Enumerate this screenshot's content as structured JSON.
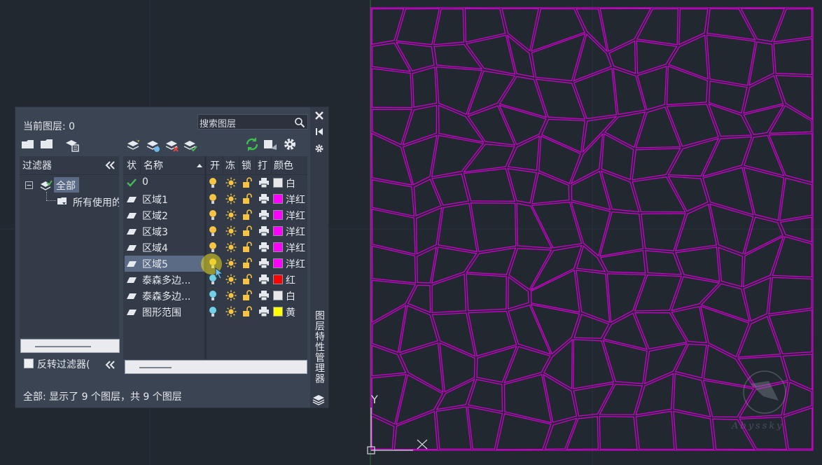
{
  "palette": {
    "current_layer": "当前图层: 0",
    "search_placeholder": "搜索图层",
    "filter_title": "过滤器",
    "filter_tree": {
      "root": "全部",
      "child": "所有使用的"
    },
    "invert_filter_label": "反转过滤器(",
    "columns": {
      "status": "状",
      "name": "名称",
      "on": "开",
      "freeze": "冻",
      "lock": "锁",
      "plot": "打",
      "color": "颜色"
    },
    "layers": [
      {
        "status": "current",
        "name": "0",
        "on": true,
        "color_name": "白",
        "color": "#e8e8e8"
      },
      {
        "status": "normal",
        "name": "区域1",
        "on": true,
        "color_name": "洋红",
        "color": "#ff00ff"
      },
      {
        "status": "normal",
        "name": "区域2",
        "on": true,
        "color_name": "洋红",
        "color": "#ff00ff"
      },
      {
        "status": "normal",
        "name": "区域3",
        "on": true,
        "color_name": "洋红",
        "color": "#ff00ff"
      },
      {
        "status": "normal",
        "name": "区域4",
        "on": true,
        "color_name": "洋红",
        "color": "#ff00ff"
      },
      {
        "status": "normal",
        "name": "区域5",
        "on": true,
        "color_name": "洋红",
        "color": "#ff00ff",
        "selected": true
      },
      {
        "status": "normal",
        "name": "泰森多边...",
        "on": false,
        "color_name": "红",
        "color": "#ff0000"
      },
      {
        "status": "normal",
        "name": "泰森多边...",
        "on": false,
        "color_name": "白",
        "color": "#e8e8e8"
      },
      {
        "status": "normal",
        "name": "图形范围",
        "on": false,
        "color_name": "黄",
        "color": "#ffff00"
      }
    ],
    "status_text": "全部: 显示了 9 个图层，共 9 个图层",
    "side_title": "图层特性管理器"
  },
  "canvas": {
    "ucs_y_label": "Y",
    "line_color": "#cc00cc",
    "background": "#212830",
    "watermark": "Abyssky"
  }
}
